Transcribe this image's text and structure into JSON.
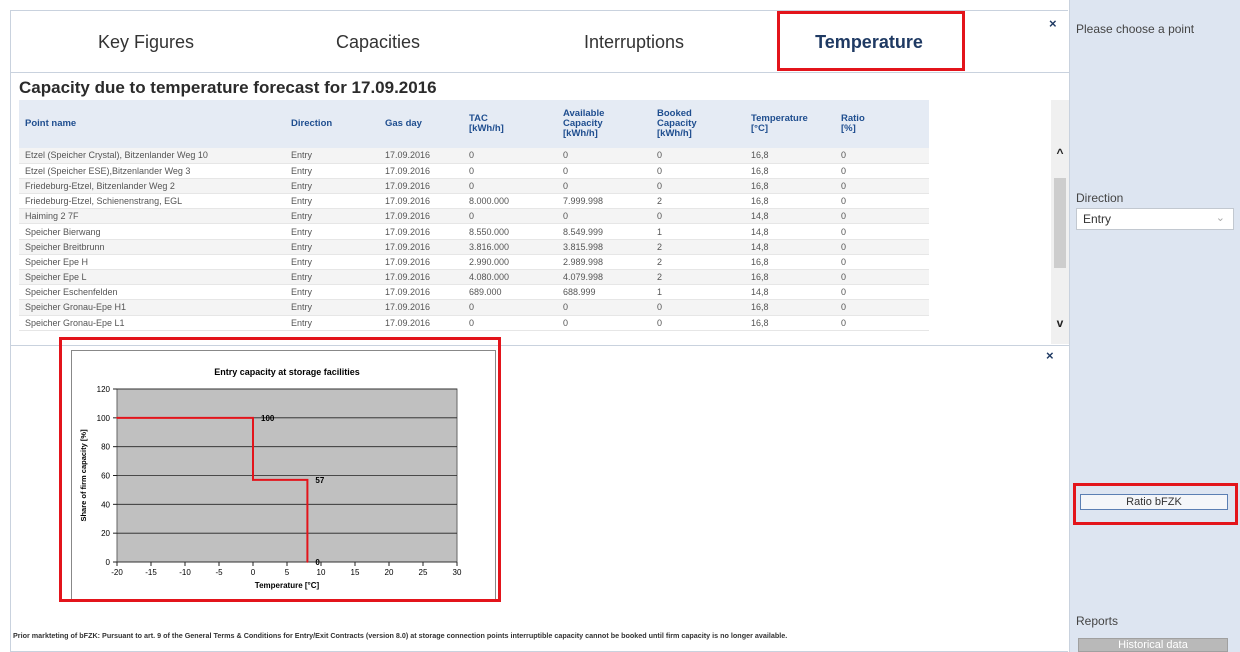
{
  "tabs": [
    {
      "label": "Key Figures"
    },
    {
      "label": "Capacities"
    },
    {
      "label": "Interruptions"
    },
    {
      "label": "Temperature"
    }
  ],
  "close_icon": "×",
  "page_title": "Capacity due to temperature forecast for 17.09.2016",
  "table": {
    "headers": [
      "Point name",
      "Direction",
      "Gas day",
      "TAC\n[kWh/h]",
      "Available\nCapacity\n[kWh/h]",
      "Booked\nCapacity\n[kWh/h]",
      "Temperature\n[°C]",
      "Ratio\n[%]"
    ],
    "rows": [
      [
        "Etzel (Speicher Crystal), Bitzenlander Weg 10",
        "Entry",
        "17.09.2016",
        "0",
        "0",
        "0",
        "16,8",
        "0"
      ],
      [
        "Etzel (Speicher ESE),Bitzenlander Weg 3",
        "Entry",
        "17.09.2016",
        "0",
        "0",
        "0",
        "16,8",
        "0"
      ],
      [
        "Friedeburg-Etzel, Bitzenlander Weg 2",
        "Entry",
        "17.09.2016",
        "0",
        "0",
        "0",
        "16,8",
        "0"
      ],
      [
        "Friedeburg-Etzel, Schienenstrang, EGL",
        "Entry",
        "17.09.2016",
        "8.000.000",
        "7.999.998",
        "2",
        "16,8",
        "0"
      ],
      [
        "Haiming 2 7F",
        "Entry",
        "17.09.2016",
        "0",
        "0",
        "0",
        "14,8",
        "0"
      ],
      [
        "Speicher Bierwang",
        "Entry",
        "17.09.2016",
        "8.550.000",
        "8.549.999",
        "1",
        "14,8",
        "0"
      ],
      [
        "Speicher Breitbrunn",
        "Entry",
        "17.09.2016",
        "3.816.000",
        "3.815.998",
        "2",
        "14,8",
        "0"
      ],
      [
        "Speicher Epe H",
        "Entry",
        "17.09.2016",
        "2.990.000",
        "2.989.998",
        "2",
        "16,8",
        "0"
      ],
      [
        "Speicher Epe L",
        "Entry",
        "17.09.2016",
        "4.080.000",
        "4.079.998",
        "2",
        "16,8",
        "0"
      ],
      [
        "Speicher Eschenfelden",
        "Entry",
        "17.09.2016",
        "689.000",
        "688.999",
        "1",
        "14,8",
        "0"
      ],
      [
        "Speicher Gronau-Epe H1",
        "Entry",
        "17.09.2016",
        "0",
        "0",
        "0",
        "16,8",
        "0"
      ],
      [
        "Speicher Gronau-Epe L1",
        "Entry",
        "17.09.2016",
        "0",
        "0",
        "0",
        "16,8",
        "0"
      ]
    ]
  },
  "scroll": {
    "up_icon": "^",
    "down_icon": "v"
  },
  "chart_data": {
    "type": "line",
    "title": "Entry capacity at storage facilities",
    "xlabel": "Temperature [°C]",
    "ylabel": "Share of firm capacity [%]",
    "xlim": [
      -20,
      30
    ],
    "ylim": [
      0,
      120
    ],
    "xticks": [
      -20,
      -15,
      -10,
      -5,
      0,
      5,
      10,
      15,
      20,
      25,
      30
    ],
    "yticks": [
      0,
      20,
      40,
      60,
      80,
      100,
      120
    ],
    "grid": true,
    "series": [
      {
        "color": "#e3141b",
        "x": [
          -20,
          0,
          0,
          8,
          8
        ],
        "y": [
          100,
          100,
          57,
          57,
          0
        ]
      }
    ],
    "annotations": [
      {
        "x": 0,
        "y": 100,
        "text": "100"
      },
      {
        "x": 8,
        "y": 57,
        "text": "57"
      },
      {
        "x": 8,
        "y": 0,
        "text": "0"
      }
    ]
  },
  "footnote": "Prior markteting of bFZK: Pursuant to art. 9 of the General Terms & Conditions for Entry/Exit Contracts (version 8.0) at storage connection points interruptible capacity cannot be booked until firm capacity is no longer available.",
  "sidebar": {
    "choose_point": "Please choose a point",
    "direction_label": "Direction",
    "direction_value": "Entry",
    "ratio_button": "Ratio bFZK",
    "reports_label": "Reports",
    "historical_button": "Historical data"
  },
  "colors": {
    "highlight": "#e3141b",
    "header_text": "#1f4e8f",
    "sidebar_bg": "#dde5f1"
  }
}
